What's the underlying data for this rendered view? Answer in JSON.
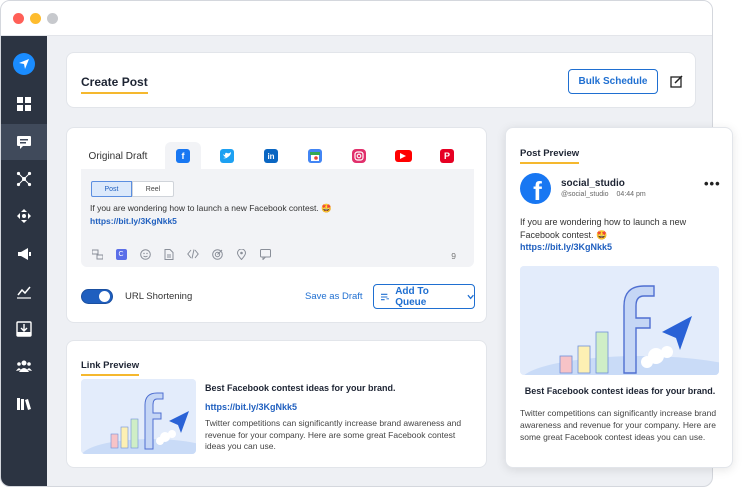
{
  "create_post": {
    "title": "Create Post",
    "bulk_schedule_label": "Bulk Schedule"
  },
  "composer": {
    "tabs": [
      {
        "label": "Original Draft"
      },
      {
        "name": "facebook",
        "color": "#1877f2"
      },
      {
        "name": "twitter",
        "color": "#1da1f2"
      },
      {
        "name": "linkedin",
        "color": "#0a66c2"
      },
      {
        "name": "google-business",
        "color": "#4285f4"
      },
      {
        "name": "instagram",
        "color": "#e1306c"
      },
      {
        "name": "youtube",
        "color": "#ff0000"
      },
      {
        "name": "pinterest",
        "color": "#e60023"
      }
    ],
    "post_type": {
      "post_label": "Post",
      "reel_label": "Reel"
    },
    "text": "If you are wondering how to launch a new Facebook contest.",
    "emoji": "🤩",
    "link": "https://bit.ly/3KgNkk5",
    "char_count": "9",
    "url_shortening_label": "URL Shortening",
    "save_draft_label": "Save as Draft",
    "add_to_queue_label": "Add To Queue"
  },
  "link_preview": {
    "title": "Link Preview",
    "headline": "Best Facebook contest ideas for your brand.",
    "link": "https://bit.ly/3KgNkk5",
    "description": "Twitter competitions can significantly increase brand awareness and revenue for your company. Here are some great Facebook contest ideas you can use."
  },
  "post_preview": {
    "title": "Post Preview",
    "account_name": "social_studio",
    "handle": "@social_studio",
    "time": "04:44 pm",
    "text": "If you are wondering how to launch a new Facebook contest.",
    "emoji": "🤩",
    "link": "https://bit.ly/3KgNkk5",
    "headline": "Best Facebook contest ideas for your brand.",
    "description": "Twitter competitions can significantly increase brand awareness and revenue for your company. Here are some great Facebook contest ideas you can use."
  },
  "colors": {
    "accent": "#1f6fd1",
    "sidebar": "#2c3442",
    "underline": "#f5b82e"
  }
}
